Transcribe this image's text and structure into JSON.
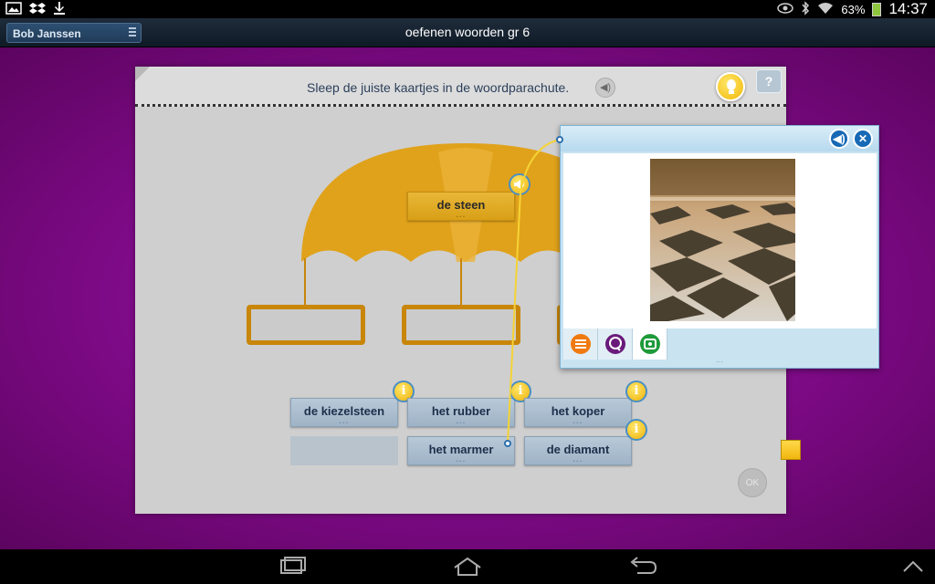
{
  "status": {
    "battery": "63%",
    "time": "14:37"
  },
  "appbar": {
    "user": "Bob Janssen",
    "title": "oefenen woorden gr 6"
  },
  "exercise": {
    "instruction": "Sleep de juiste kaartjes in de woordparachute.",
    "parachute_word": "de steen",
    "cards": [
      "de kiezelsteen",
      "het rubber",
      "het koper",
      "het marmer",
      "de diamant"
    ],
    "ok_label": "OK",
    "help_label": "?"
  },
  "popup": {
    "image_subject": "checkered-marble-floor"
  },
  "colors": {
    "stage": "#7d0a86",
    "card": "#cfcfcf",
    "parachute": "#e0a21a",
    "popup_accent": "#1669b5"
  }
}
